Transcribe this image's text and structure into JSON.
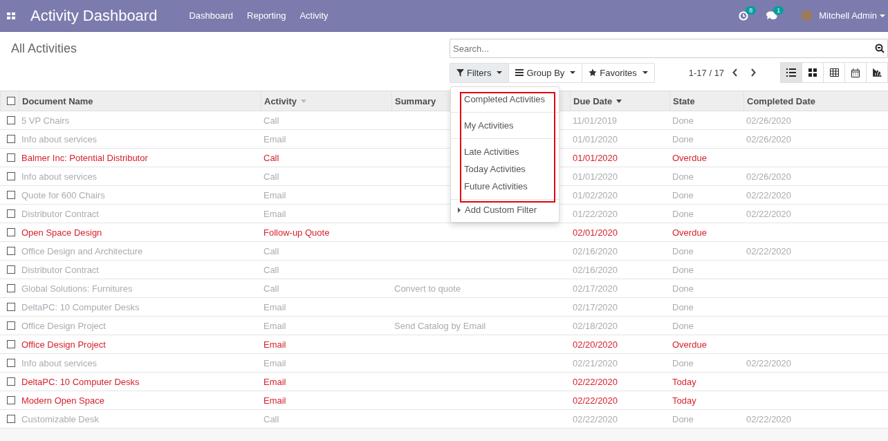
{
  "navbar": {
    "title": "Activity Dashboard",
    "menu": [
      "Dashboard",
      "Reporting",
      "Activity"
    ],
    "activity_badge": "8",
    "messages_badge": "1",
    "user": "Mitchell Admin"
  },
  "control_panel": {
    "breadcrumb": "All Activities",
    "search": {
      "placeholder": "Search..."
    },
    "search_buttons": [
      {
        "label": "Filters",
        "kind": "filter",
        "selected": true
      },
      {
        "label": "Group By",
        "kind": "group",
        "selected": false
      },
      {
        "label": "Favorites",
        "kind": "star",
        "selected": false
      }
    ],
    "pager": "1-17 / 17",
    "views": [
      {
        "kind": "list",
        "selected": true
      },
      {
        "kind": "kanban",
        "selected": false
      },
      {
        "kind": "grid",
        "selected": false
      },
      {
        "kind": "calendar",
        "selected": false
      },
      {
        "kind": "graph",
        "selected": false
      }
    ]
  },
  "filter_menu": {
    "groups": [
      [
        "Completed Activities"
      ],
      [
        "My Activities"
      ],
      [
        "Late Activities",
        "Today Activities",
        "Future Activities"
      ]
    ],
    "add_custom": "Add Custom Filter"
  },
  "table": {
    "select_all_checked": false,
    "columns": [
      {
        "label": "Document Name",
        "sorted": false,
        "sort_hint": false
      },
      {
        "label": "Activity",
        "sorted": false,
        "sort_hint": true
      },
      {
        "label": "Summary",
        "sorted": false,
        "sort_hint": false
      },
      {
        "label": "Due Date",
        "sorted": true
      },
      {
        "label": "State",
        "sorted": false,
        "sort_hint": false
      },
      {
        "label": "Completed Date",
        "sorted": false,
        "sort_hint": false
      }
    ],
    "rows": [
      {
        "kind": "done",
        "checked": false,
        "cells": [
          "5 VP Chairs",
          "Call",
          "",
          "11/01/2019",
          "Done",
          "02/26/2020"
        ]
      },
      {
        "kind": "done",
        "checked": false,
        "cells": [
          "Info about services",
          "Email",
          "",
          "01/01/2020",
          "Done",
          "02/26/2020"
        ]
      },
      {
        "kind": "late",
        "checked": false,
        "cells": [
          "Balmer Inc: Potential Distributor",
          "Call",
          "",
          "01/01/2020",
          "Overdue",
          ""
        ]
      },
      {
        "kind": "done",
        "checked": false,
        "cells": [
          "Info about services",
          "Call",
          "",
          "01/01/2020",
          "Done",
          "02/26/2020"
        ]
      },
      {
        "kind": "done",
        "checked": false,
        "cells": [
          "Quote for 600 Chairs",
          "Email",
          "",
          "01/02/2020",
          "Done",
          "02/22/2020"
        ]
      },
      {
        "kind": "done",
        "checked": false,
        "cells": [
          "Distributor Contract",
          "Email",
          "",
          "01/22/2020",
          "Done",
          "02/22/2020"
        ]
      },
      {
        "kind": "late",
        "checked": false,
        "cells": [
          "Open Space Design",
          "Follow-up Quote",
          "",
          "02/01/2020",
          "Overdue",
          ""
        ]
      },
      {
        "kind": "done",
        "checked": false,
        "cells": [
          "Office Design and Architecture",
          "Call",
          "",
          "02/16/2020",
          "Done",
          "02/22/2020"
        ]
      },
      {
        "kind": "done",
        "checked": false,
        "cells": [
          "Distributor Contract",
          "Call",
          "",
          "02/16/2020",
          "Done",
          ""
        ]
      },
      {
        "kind": "done",
        "checked": false,
        "cells": [
          "Global Solutions: Furnitures",
          "Call",
          "Convert to quote",
          "02/17/2020",
          "Done",
          ""
        ]
      },
      {
        "kind": "done",
        "checked": false,
        "cells": [
          "DeltaPC: 10 Computer Desks",
          "Email",
          "",
          "02/17/2020",
          "Done",
          ""
        ]
      },
      {
        "kind": "done",
        "checked": false,
        "cells": [
          "Office Design Project",
          "Email",
          "Send Catalog by Email",
          "02/18/2020",
          "Done",
          ""
        ]
      },
      {
        "kind": "late",
        "checked": false,
        "cells": [
          "Office Design Project",
          "Email",
          "",
          "02/20/2020",
          "Overdue",
          ""
        ]
      },
      {
        "kind": "done",
        "checked": false,
        "cells": [
          "Info about services",
          "Email",
          "",
          "02/21/2020",
          "Done",
          "02/22/2020"
        ]
      },
      {
        "kind": "late",
        "checked": false,
        "cells": [
          "DeltaPC: 10 Computer Desks",
          "Email",
          "",
          "02/22/2020",
          "Today",
          ""
        ]
      },
      {
        "kind": "late",
        "checked": false,
        "cells": [
          "Modern Open Space",
          "Email",
          "",
          "02/22/2020",
          "Today",
          ""
        ]
      },
      {
        "kind": "done",
        "checked": false,
        "cells": [
          "Customizable Desk",
          "Call",
          "",
          "02/22/2020",
          "Done",
          "02/22/2020"
        ]
      }
    ]
  }
}
